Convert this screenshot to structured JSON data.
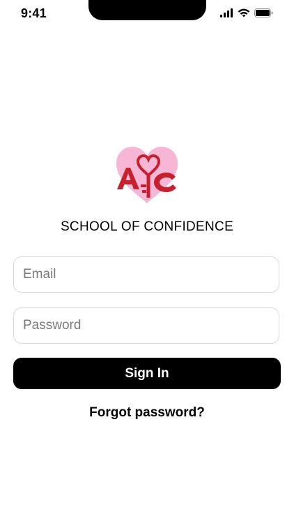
{
  "status_bar": {
    "time": "9:41",
    "icons": [
      "cellular-signal-icon",
      "wifi-icon",
      "battery-icon"
    ]
  },
  "logo": {
    "icon": "heart-key-logo",
    "letters": "AC",
    "colors": {
      "heart": "#f7b6d6",
      "letters": "#c4202e"
    }
  },
  "brand": {
    "title": "SCHOOL OF CONFIDENCE"
  },
  "form": {
    "email_placeholder": "Email",
    "password_placeholder": "Password",
    "sign_in_label": "Sign In",
    "forgot_label": "Forgot password?"
  },
  "colors": {
    "primary_button": "#000000",
    "primary_button_text": "#ffffff",
    "field_border": "#d9d9d9",
    "placeholder": "#7a7a7a"
  }
}
